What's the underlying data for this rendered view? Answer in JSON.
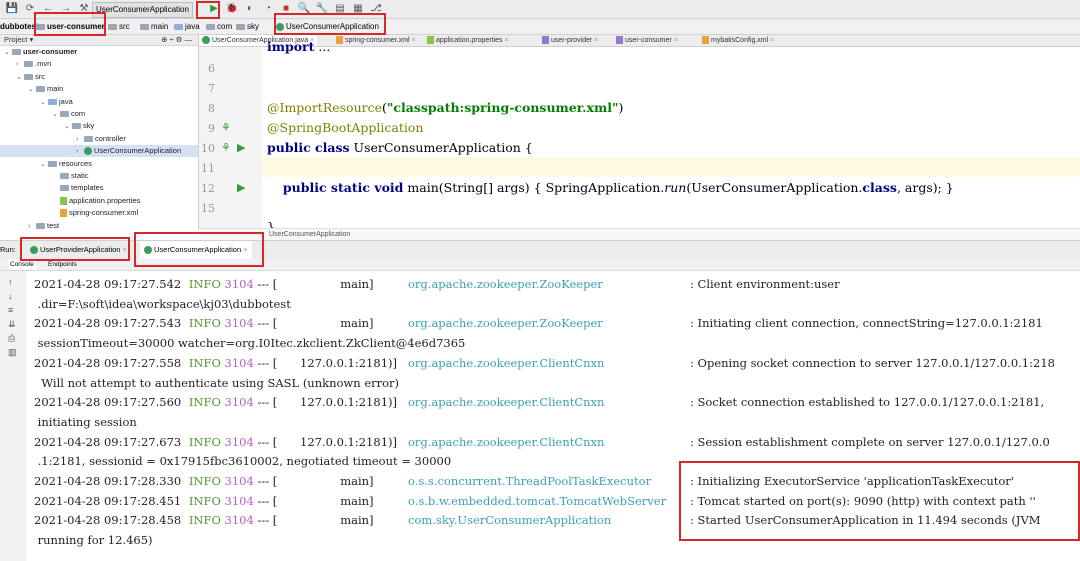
{
  "toolbar": {
    "run_config": "UserConsumerApplication",
    "icons": [
      "save-icon",
      "sync-icon",
      "back-icon",
      "forward-icon",
      "build-icon",
      "run-config-icon",
      "run-icon",
      "debug-icon",
      "coverage-icon",
      "profile-icon",
      "stop-icon",
      "search-icon",
      "settings-icon",
      "structure-icon",
      "project-structure-icon",
      "vcs-icon"
    ]
  },
  "navbar": {
    "crumbs": [
      "dubbotest",
      "user-consumer",
      "src",
      "main",
      "java",
      "com",
      "sky",
      "UserConsumerApplication"
    ]
  },
  "project_panel": {
    "title": "Project",
    "tree": [
      {
        "label": "user-consumer",
        "depth": 0,
        "arrow": "v",
        "icon": "folder",
        "bold": true
      },
      {
        "label": ".mvn",
        "depth": 1,
        "arrow": ">",
        "icon": "folder"
      },
      {
        "label": "src",
        "depth": 1,
        "arrow": "v",
        "icon": "folder"
      },
      {
        "label": "main",
        "depth": 2,
        "arrow": "v",
        "icon": "folder"
      },
      {
        "label": "java",
        "depth": 3,
        "arrow": "v",
        "icon": "folder-blue"
      },
      {
        "label": "com",
        "depth": 4,
        "arrow": "v",
        "icon": "folder"
      },
      {
        "label": "sky",
        "depth": 5,
        "arrow": "v",
        "icon": "folder"
      },
      {
        "label": "controller",
        "depth": 6,
        "arrow": ">",
        "icon": "folder"
      },
      {
        "label": "UserConsumerApplication",
        "depth": 6,
        "arrow": ">",
        "icon": "class",
        "selected": true
      },
      {
        "label": "resources",
        "depth": 3,
        "arrow": "v",
        "icon": "folder"
      },
      {
        "label": "static",
        "depth": 4,
        "arrow": "",
        "icon": "folder"
      },
      {
        "label": "templates",
        "depth": 4,
        "arrow": "",
        "icon": "folder"
      },
      {
        "label": "application.properties",
        "depth": 4,
        "arrow": "",
        "icon": "file"
      },
      {
        "label": "spring-consumer.xml",
        "depth": 4,
        "arrow": "",
        "icon": "xml"
      },
      {
        "label": "test",
        "depth": 2,
        "arrow": ">",
        "icon": "folder"
      }
    ]
  },
  "editor_tabs": [
    {
      "label": "UserConsumerApplication.java",
      "active": true
    },
    {
      "label": "spring-consumer.xml"
    },
    {
      "label": "application.properties"
    },
    {
      "label": "user-provider"
    },
    {
      "label": "user-consumer"
    },
    {
      "label": "mybatisConfig.xml"
    }
  ],
  "editor": {
    "lines": [
      {
        "num": "",
        "html": "<span class=\"kw\">import</span> ..."
      },
      {
        "num": "6",
        "html": ""
      },
      {
        "num": "7",
        "html": ""
      },
      {
        "num": "8",
        "html": "<span class=\"ann\">@ImportResource</span>(<span class=\"str\">\"classpath:spring-consumer.xml\"</span>)"
      },
      {
        "num": "9",
        "html": "<span class=\"ann\">@SpringBootApplication</span>"
      },
      {
        "num": "10",
        "html": "<span class=\"kw\">public class</span> UserConsumerApplication {"
      },
      {
        "num": "11",
        "html": ""
      },
      {
        "num": "12",
        "html": "    <span class=\"kw\">public static void</span> main(String[] args) { SpringApplication.<span class=\"it\">run</span>(UserConsumerApplication.<span class=\"kw\">class</span>, args); }"
      },
      {
        "num": "15",
        "html": ""
      },
      {
        "num": "",
        "html": "}"
      }
    ],
    "bottom_crumb": "UserConsumerApplication"
  },
  "run_tabs": [
    {
      "label": "UserProviderApplication"
    },
    {
      "label": "UserConsumerApplication",
      "active": true
    }
  ],
  "run_label": "Run:",
  "sub_tabs": [
    "Console",
    "Endpoints"
  ],
  "console": {
    "lines": [
      {
        "ts": "2021-04-28 09:17:27.542",
        "level": "INFO",
        "pid": "3104",
        "sep": "--- [",
        "thread": "           main]",
        "logger": "org.apache.zookeeper.ZooKeeper",
        "msg": ": Client environment:user"
      },
      {
        "cont": " .dir=F:\\soft\\idea\\workspace\\kj03\\dubbotest"
      },
      {
        "ts": "2021-04-28 09:17:27.543",
        "level": "INFO",
        "pid": "3104",
        "sep": "--- [",
        "thread": "           main]",
        "logger": "org.apache.zookeeper.ZooKeeper",
        "msg": ": Initiating client connection, connectString=127.0.0.1:2181"
      },
      {
        "cont": " sessionTimeout=30000 watcher=org.I0Itec.zkclient.ZkClient@4e6d7365"
      },
      {
        "ts": "2021-04-28 09:17:27.558",
        "level": "INFO",
        "pid": "3104",
        "sep": "--- [",
        "thread": "127.0.0.1:2181)]",
        "logger": "org.apache.zookeeper.ClientCnxn",
        "msg": ": Opening socket connection to server 127.0.0.1/127.0.0.1:218"
      },
      {
        "cont": "  Will not attempt to authenticate using SASL (unknown error)"
      },
      {
        "ts": "2021-04-28 09:17:27.560",
        "level": "INFO",
        "pid": "3104",
        "sep": "--- [",
        "thread": "127.0.0.1:2181)]",
        "logger": "org.apache.zookeeper.ClientCnxn",
        "msg": ": Socket connection established to 127.0.0.1/127.0.0.1:2181,"
      },
      {
        "cont": " initiating session"
      },
      {
        "ts": "2021-04-28 09:17:27.673",
        "level": "INFO",
        "pid": "3104",
        "sep": "--- [",
        "thread": "127.0.0.1:2181)]",
        "logger": "org.apache.zookeeper.ClientCnxn",
        "msg": ": Session establishment complete on server 127.0.0.1/127.0.0"
      },
      {
        "cont": " .1:2181, sessionid = 0x17915fbc3610002, negotiated timeout = 30000"
      },
      {
        "ts": "2021-04-28 09:17:28.330",
        "level": "INFO",
        "pid": "3104",
        "sep": "--- [",
        "thread": "           main]",
        "logger": "o.s.s.concurrent.ThreadPoolTaskExecutor",
        "msg": ": Initializing ExecutorService 'applicationTaskExecutor'"
      },
      {
        "ts": "2021-04-28 09:17:28.451",
        "level": "INFO",
        "pid": "3104",
        "sep": "--- [",
        "thread": "           main]",
        "logger": "o.s.b.w.embedded.tomcat.TomcatWebServer",
        "msg": ": Tomcat started on port(s): 9090 (http) with context path ''"
      },
      {
        "ts": "2021-04-28 09:17:28.458",
        "level": "INFO",
        "pid": "3104",
        "sep": "--- [",
        "thread": "           main]",
        "logger": "com.sky.UserConsumerApplication",
        "msg": ": Started UserConsumerApplication in 11.494 seconds (JVM"
      },
      {
        "cont": " running for 12.465)"
      }
    ]
  },
  "colors": {
    "highlight_border": "#d62828",
    "info": "#4f9b2f",
    "pid": "#b65ec6",
    "logger": "#3aa0b5"
  }
}
